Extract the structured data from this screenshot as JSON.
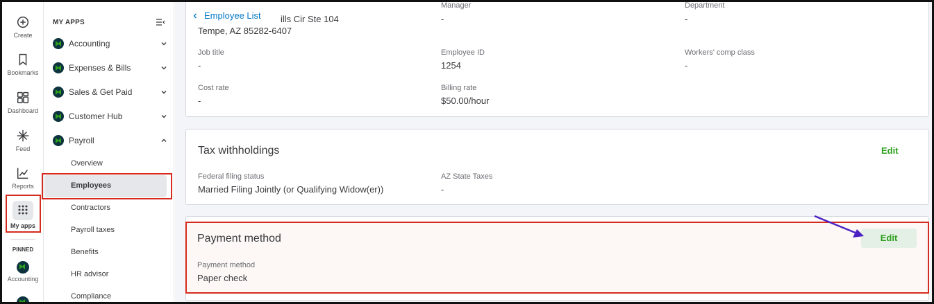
{
  "rail": {
    "items": [
      {
        "label": "Create",
        "icon": "plus-circle-icon"
      },
      {
        "label": "Bookmarks",
        "icon": "bookmark-icon"
      },
      {
        "label": "Dashboard",
        "icon": "dashboard-icon"
      },
      {
        "label": "Feed",
        "icon": "feed-icon"
      },
      {
        "label": "Reports",
        "icon": "chart-icon"
      },
      {
        "label": "My apps",
        "icon": "grid-dots-icon"
      }
    ],
    "pinned_label": "PINNED",
    "pinned_items": [
      {
        "label": "Accounting",
        "icon": "accounting-logo-icon"
      }
    ]
  },
  "appmenu": {
    "title": "MY APPS",
    "apps": [
      {
        "label": "Accounting"
      },
      {
        "label": "Expenses & Bills"
      },
      {
        "label": "Sales & Get Paid"
      },
      {
        "label": "Customer Hub"
      },
      {
        "label": "Payroll"
      }
    ],
    "payroll_items": [
      {
        "label": "Overview"
      },
      {
        "label": "Employees"
      },
      {
        "label": "Contractors"
      },
      {
        "label": "Payroll taxes"
      },
      {
        "label": "Benefits"
      },
      {
        "label": "HR advisor"
      },
      {
        "label": "Compliance"
      }
    ]
  },
  "main": {
    "back_link": "Employee List",
    "employment": {
      "top_labels": {
        "col2": "Manager",
        "col3": "Department"
      },
      "address_line1": "ills Cir Ste 104",
      "address_line2": "Tempe, AZ 85282-6407",
      "top_values": {
        "col2": "-",
        "col3": "-"
      },
      "job_title_label": "Job title",
      "job_title_value": "-",
      "employee_id_label": "Employee ID",
      "employee_id_value": "1254",
      "workers_comp_label": "Workers' comp class",
      "workers_comp_value": "-",
      "cost_rate_label": "Cost rate",
      "cost_rate_value": "-",
      "billing_rate_label": "Billing rate",
      "billing_rate_value": "$50.00/hour"
    },
    "tax": {
      "title": "Tax withholdings",
      "edit_label": "Edit",
      "federal_label": "Federal filing status",
      "federal_value": "Married Filing Jointly (or Qualifying Widow(er))",
      "state_label": "AZ State Taxes",
      "state_value": "-"
    },
    "payment": {
      "title": "Payment method",
      "edit_label": "Edit",
      "method_label": "Payment method",
      "method_value": "Paper check"
    }
  },
  "colors": {
    "brand_green": "#2ca01c",
    "link_blue": "#0077c5",
    "annotation_red": "#d52b1e",
    "annotation_arrow": "#4b21c2"
  }
}
